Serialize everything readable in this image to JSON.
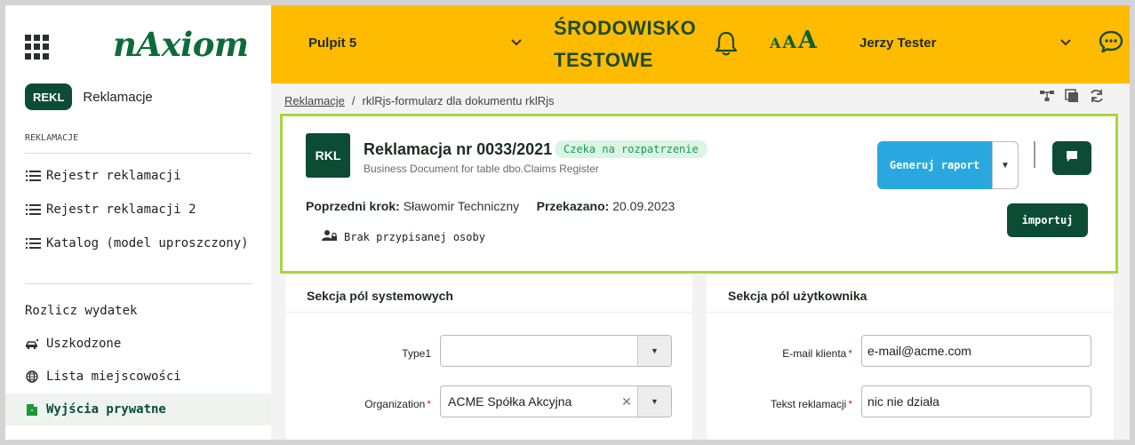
{
  "sidebar": {
    "logo": "nAxiom",
    "module_tag": "REKL",
    "module_name": "Reklamacje",
    "section_label": "REKLAMACJE",
    "items_top": [
      {
        "label": "Rejestr reklamacji",
        "icon": "list-icon"
      },
      {
        "label": "Rejestr reklamacji 2",
        "icon": "list-icon"
      },
      {
        "label": "Katalog (model uproszczony)",
        "icon": "list-icon"
      }
    ],
    "items_bottom": [
      {
        "label": "Rozlicz wydatek",
        "icon": ""
      },
      {
        "label": "Uszkodzone",
        "icon": "car-crash-icon"
      },
      {
        "label": "Lista miejscowości",
        "icon": "globe-icon"
      },
      {
        "label": "Wyjścia prywatne",
        "icon": "door-exit-icon"
      }
    ]
  },
  "topbar": {
    "dashboard": "Pulpit 5",
    "env_line1": "ŚRODOWISKO",
    "env_line2": "TESTOWE",
    "font_sizes": [
      "A",
      "A",
      "A"
    ],
    "user": "Jerzy Tester",
    "accent": "#ffbb00"
  },
  "breadcrumb": {
    "link": "Reklamacje",
    "separator": "/",
    "current": "rklRjs-formularz dla dokumentu rklRjs"
  },
  "header": {
    "badge": "RKL",
    "title": "Reklamacja nr 0033/2021",
    "status": "Czeka na rozpatrzenie",
    "subtitle": "Business Document for table dbo.Claims Register",
    "prev_step_label": "Poprzedni krok:",
    "prev_step_value": "Sławomir Techniczny",
    "passed_label": "Przekazano:",
    "passed_value": "20.09.2023",
    "assignee": "Brak przypisanej osoby",
    "generate_label": "Generuj raport",
    "import_label": "importuj"
  },
  "system_section": {
    "title": "Sekcja pól systemowych",
    "type1_label": "Type1",
    "type1_value": "",
    "org_label": "Organization",
    "org_value": "ACME Spółka Akcyjna"
  },
  "user_section": {
    "title": "Sekcja pól użytkownika",
    "email_label": "E-mail klienta",
    "email_value": "e-mail@acme.com",
    "text_label": "Tekst reklamacji",
    "text_value": "nic nie działa"
  }
}
